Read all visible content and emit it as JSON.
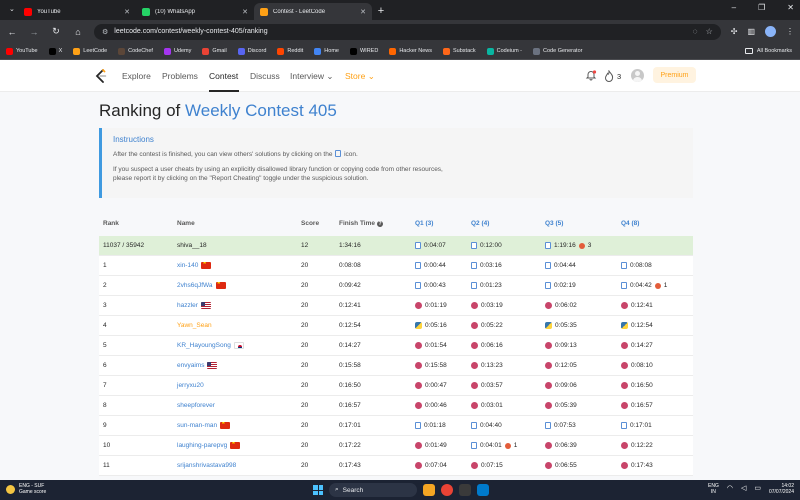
{
  "browser": {
    "tabs": [
      {
        "title": "YouTube",
        "favicon_color": "#ff0000",
        "active": false
      },
      {
        "title": "(10) WhatsApp",
        "favicon_color": "#25d366",
        "active": false
      },
      {
        "title": "Contest - LeetCode",
        "favicon_color": "#ffa116",
        "active": true
      }
    ],
    "url": "leetcode.com/contest/weekly-contest-405/ranking",
    "bookmarks": [
      {
        "label": "YouTube",
        "color": "#ff0000"
      },
      {
        "label": "X",
        "color": "#000000"
      },
      {
        "label": "LeetCode",
        "color": "#ffa116"
      },
      {
        "label": "CodeChef",
        "color": "#5b4638"
      },
      {
        "label": "Udemy",
        "color": "#a435f0"
      },
      {
        "label": "Gmail",
        "color": "#ea4335"
      },
      {
        "label": "Discord",
        "color": "#5865f2"
      },
      {
        "label": "Reddit",
        "color": "#ff4500"
      },
      {
        "label": "Home",
        "color": "#4285f4"
      },
      {
        "label": "WIRED",
        "color": "#000000"
      },
      {
        "label": "Hacker News",
        "color": "#ff6600"
      },
      {
        "label": "Substack",
        "color": "#ff6719"
      },
      {
        "label": "Codeium -",
        "color": "#09b6a2"
      },
      {
        "label": "Code Generator",
        "color": "#6b7280"
      }
    ],
    "all_bookmarks": "All Bookmarks"
  },
  "nav": {
    "items": [
      "Explore",
      "Problems",
      "Contest",
      "Discuss",
      "Interview",
      "Store"
    ],
    "streak": "3",
    "premium": "Premium"
  },
  "page": {
    "heading_prefix": "Ranking of ",
    "contest_name": "Weekly Contest 405",
    "instructions": {
      "title": "Instructions",
      "line1a": "After the contest is finished, you can view others' solutions by clicking on the",
      "line1b": "icon.",
      "line2": "If you suspect a user cheats by using an explicitly disallowed library function or copying code from other resources,",
      "line3": "please report it by clicking on the \"Report Cheating\" toggle under the suspicious solution."
    },
    "columns": [
      "Rank",
      "Name",
      "Score",
      "Finish Time",
      "Q1 (3)",
      "Q2 (4)",
      "Q3 (5)",
      "Q4 (8)"
    ],
    "rows": [
      {
        "rank": "11037 / 35942",
        "name": "shiva__18",
        "flag": "",
        "style": "plain",
        "score": "12",
        "finish": "1:34:16",
        "q": [
          {
            "t": "0:04:07",
            "lang": "doc",
            "wrong": ""
          },
          {
            "t": "0:12:00",
            "lang": "doc",
            "wrong": ""
          },
          {
            "t": "1:19:16",
            "lang": "doc",
            "wrong": "3"
          },
          {
            "t": "",
            "lang": "",
            "wrong": ""
          }
        ],
        "mine": true
      },
      {
        "rank": "1",
        "name": "xin-140",
        "flag": "cn",
        "style": "blue",
        "score": "20",
        "finish": "0:08:08",
        "q": [
          {
            "t": "0:00:44",
            "lang": "doc",
            "wrong": ""
          },
          {
            "t": "0:03:16",
            "lang": "doc",
            "wrong": ""
          },
          {
            "t": "0:04:44",
            "lang": "doc",
            "wrong": ""
          },
          {
            "t": "0:08:08",
            "lang": "doc",
            "wrong": ""
          }
        ]
      },
      {
        "rank": "2",
        "name": "2vhs6qJfWa",
        "flag": "cn",
        "style": "blue",
        "score": "20",
        "finish": "0:09:42",
        "q": [
          {
            "t": "0:00:43",
            "lang": "doc",
            "wrong": ""
          },
          {
            "t": "0:01:23",
            "lang": "doc",
            "wrong": ""
          },
          {
            "t": "0:02:19",
            "lang": "doc",
            "wrong": ""
          },
          {
            "t": "0:04:42",
            "lang": "doc",
            "wrong": "1"
          }
        ]
      },
      {
        "rank": "3",
        "name": "hazzler",
        "flag": "us",
        "style": "blue",
        "score": "20",
        "finish": "0:12:41",
        "q": [
          {
            "t": "0:01:19",
            "lang": "cpp",
            "wrong": ""
          },
          {
            "t": "0:03:19",
            "lang": "cpp",
            "wrong": ""
          },
          {
            "t": "0:06:02",
            "lang": "cpp",
            "wrong": ""
          },
          {
            "t": "0:12:41",
            "lang": "cpp",
            "wrong": ""
          }
        ]
      },
      {
        "rank": "4",
        "name": "Yawn_Sean",
        "flag": "",
        "style": "orange",
        "score": "20",
        "finish": "0:12:54",
        "q": [
          {
            "t": "0:05:16",
            "lang": "py",
            "wrong": ""
          },
          {
            "t": "0:05:22",
            "lang": "cpp",
            "wrong": ""
          },
          {
            "t": "0:05:35",
            "lang": "py",
            "wrong": ""
          },
          {
            "t": "0:12:54",
            "lang": "py",
            "wrong": ""
          }
        ]
      },
      {
        "rank": "5",
        "name": "KR_HayoungSong",
        "flag": "kr",
        "style": "blue",
        "score": "20",
        "finish": "0:14:27",
        "q": [
          {
            "t": "0:01:54",
            "lang": "cpp",
            "wrong": ""
          },
          {
            "t": "0:06:16",
            "lang": "cpp",
            "wrong": ""
          },
          {
            "t": "0:09:13",
            "lang": "cpp",
            "wrong": ""
          },
          {
            "t": "0:14:27",
            "lang": "cpp",
            "wrong": ""
          }
        ]
      },
      {
        "rank": "6",
        "name": "envyaims",
        "flag": "us",
        "style": "blue",
        "score": "20",
        "finish": "0:15:58",
        "q": [
          {
            "t": "0:15:58",
            "lang": "cpp",
            "wrong": ""
          },
          {
            "t": "0:13:23",
            "lang": "cpp",
            "wrong": ""
          },
          {
            "t": "0:12:05",
            "lang": "cpp",
            "wrong": ""
          },
          {
            "t": "0:08:10",
            "lang": "cpp",
            "wrong": ""
          }
        ]
      },
      {
        "rank": "7",
        "name": "jerryxu20",
        "flag": "",
        "style": "blue",
        "score": "20",
        "finish": "0:16:50",
        "q": [
          {
            "t": "0:00:47",
            "lang": "cpp",
            "wrong": ""
          },
          {
            "t": "0:03:57",
            "lang": "cpp",
            "wrong": ""
          },
          {
            "t": "0:09:06",
            "lang": "cpp",
            "wrong": ""
          },
          {
            "t": "0:16:50",
            "lang": "cpp",
            "wrong": ""
          }
        ]
      },
      {
        "rank": "8",
        "name": "sheepforever",
        "flag": "",
        "style": "blue",
        "score": "20",
        "finish": "0:16:57",
        "q": [
          {
            "t": "0:00:46",
            "lang": "cpp",
            "wrong": ""
          },
          {
            "t": "0:03:01",
            "lang": "cpp",
            "wrong": ""
          },
          {
            "t": "0:05:39",
            "lang": "cpp",
            "wrong": ""
          },
          {
            "t": "0:16:57",
            "lang": "cpp",
            "wrong": ""
          }
        ]
      },
      {
        "rank": "9",
        "name": "sun-man-man",
        "flag": "cn",
        "style": "blue",
        "score": "20",
        "finish": "0:17:01",
        "q": [
          {
            "t": "0:01:18",
            "lang": "doc",
            "wrong": ""
          },
          {
            "t": "0:04:40",
            "lang": "doc",
            "wrong": ""
          },
          {
            "t": "0:07:53",
            "lang": "doc",
            "wrong": ""
          },
          {
            "t": "0:17:01",
            "lang": "doc",
            "wrong": ""
          }
        ]
      },
      {
        "rank": "10",
        "name": "laughing-parepvg",
        "flag": "cn",
        "style": "blue",
        "score": "20",
        "finish": "0:17:22",
        "q": [
          {
            "t": "0:01:49",
            "lang": "cpp",
            "wrong": ""
          },
          {
            "t": "0:04:01",
            "lang": "doc",
            "wrong": "1"
          },
          {
            "t": "0:06:39",
            "lang": "cpp",
            "wrong": ""
          },
          {
            "t": "0:12:22",
            "lang": "cpp",
            "wrong": ""
          }
        ]
      },
      {
        "rank": "11",
        "name": "srijanshrivastava998",
        "flag": "",
        "style": "blue",
        "score": "20",
        "finish": "0:17:43",
        "q": [
          {
            "t": "0:07:04",
            "lang": "cpp",
            "wrong": ""
          },
          {
            "t": "0:07:15",
            "lang": "cpp",
            "wrong": ""
          },
          {
            "t": "0:06:55",
            "lang": "cpp",
            "wrong": ""
          },
          {
            "t": "0:17:43",
            "lang": "cpp",
            "wrong": ""
          }
        ]
      }
    ]
  },
  "taskbar": {
    "weather_line1": "ENG - SUF",
    "weather_line2": "Game score",
    "search": "Search",
    "lang_line1": "ENG",
    "lang_line2": "IN",
    "time": "14:02",
    "date": "07/07/2024"
  }
}
